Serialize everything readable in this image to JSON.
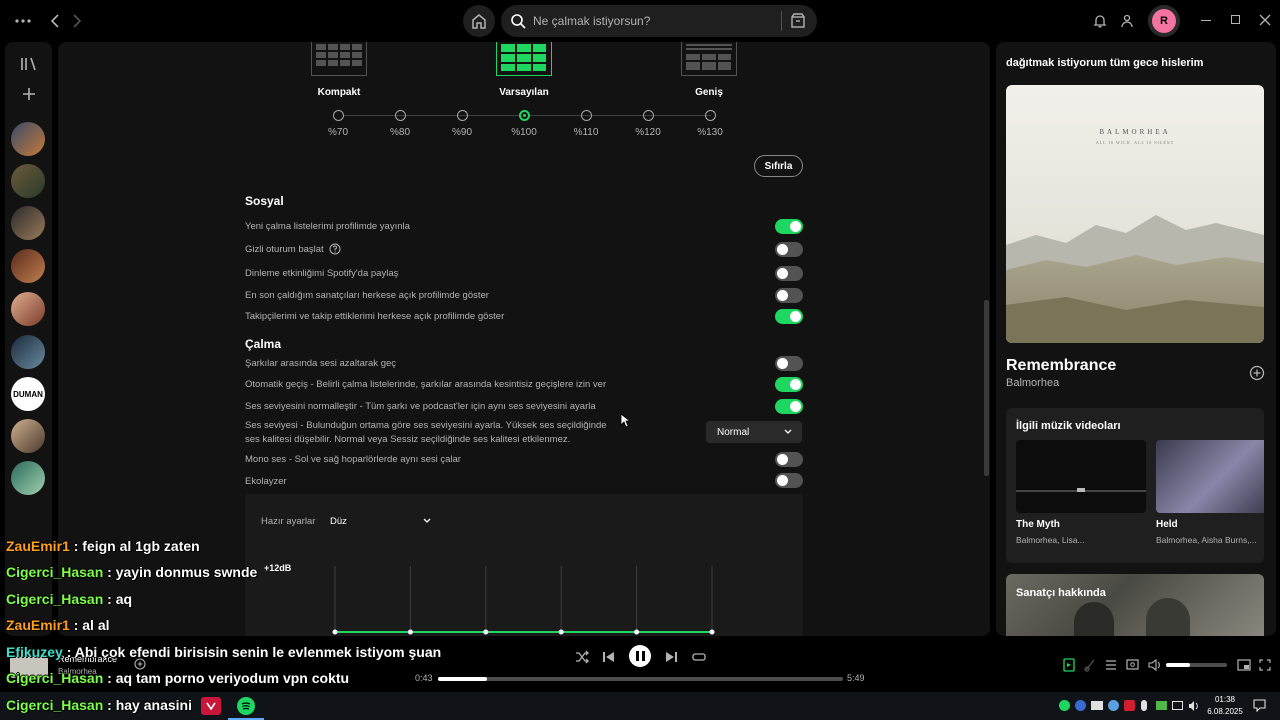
{
  "topbar": {
    "search_placeholder": "Ne çalmak istiyorsun?",
    "profile_initial": "R",
    "profile_color": "#f573a0"
  },
  "left_sidebar": {
    "avatars": [
      "artist-1",
      "artist-2",
      "artist-3",
      "artist-4",
      "artist-5",
      "artist-6",
      "DUMAN",
      "artist-8",
      "artist-9"
    ]
  },
  "display": {
    "layouts": [
      {
        "label": "Kompakt"
      },
      {
        "label": "Varsayılan"
      },
      {
        "label": "Geniş"
      }
    ],
    "zoom_levels": [
      "%70",
      "%80",
      "%90",
      "%100",
      "%110",
      "%120",
      "%130"
    ],
    "selected_zoom": "%100",
    "reset_label": "Sıfırla"
  },
  "social": {
    "title": "Sosyal",
    "rows": [
      {
        "label": "Yeni çalma listelerimi profilimde yayınla",
        "on": true
      },
      {
        "label": "Gizli oturum başlat",
        "on": false
      },
      {
        "label": "Dinleme etkinliğimi Spotify'da paylaş",
        "on": false
      },
      {
        "label": "En son çaldığım sanatçıları herkese açık profilimde göster",
        "on": false
      },
      {
        "label": "Takipçilerimi ve takip ettiklerimi herkese açık profilimde göster",
        "on": true
      }
    ]
  },
  "playback": {
    "title": "Çalma",
    "crossfade": {
      "label": "Şarkılar arasında sesi azaltarak geç",
      "on": false
    },
    "automix": {
      "label": "Otomatik geçiş - Belirli çalma listelerinde, şarkılar arasında kesintisiz geçişlere izin ver",
      "on": true
    },
    "normalize": {
      "label": "Ses seviyesini normalleştir - Tüm şarkı ve podcast'ler için aynı ses seviyesini ayarla",
      "on": true
    },
    "volume_level": {
      "label_line1": "Ses seviyesi - Bulunduğun ortama göre ses seviyesini ayarla. Yüksek ses seçildiğinde",
      "label_line2": "ses kalitesi düşebilir. Normal veya Sessiz seçildiğinde ses kalitesi etkilenmez.",
      "value": "Normal"
    },
    "mono": {
      "label": "Mono ses - Sol ve sağ hoparlörlerde aynı sesi çalar",
      "on": false
    },
    "equalizer": {
      "label": "Ekolayzer",
      "on": false
    }
  },
  "equalizer_panel": {
    "preset_label": "Hazır ayarlar",
    "preset_value": "Düz",
    "db_label": "+12dB",
    "band_count": 6
  },
  "right_panel": {
    "playlist_title": "dağıtmak istiyorum tüm gece hislerim",
    "album_art_text": "BALMORHEA",
    "album_art_subtext": "ALL IS WILD, ALL IS SILENT",
    "track_title": "Remembrance",
    "track_artist": "Balmorhea",
    "videos_title": "İlgili müzik videoları",
    "videos": [
      {
        "title": "The Myth",
        "artists": "Balmorhea, Lisa..."
      },
      {
        "title": "Held",
        "artists": "Balmorhea, Aisha Burns,..."
      }
    ],
    "about_title": "Sanatçı hakkında"
  },
  "player": {
    "track_title": "Remembrance",
    "track_artist": "Balmorhea",
    "elapsed": "0:43",
    "duration": "5:49",
    "progress": 0.12,
    "volume": 0.4
  },
  "chat": [
    {
      "user": "ZauEmir1",
      "message": " : feign al 1gb zaten",
      "color": "#ff9f1a"
    },
    {
      "user": "Cigerci_Hasan",
      "message": " : yayin donmus swnde",
      "color": "#7dff4a"
    },
    {
      "user": "Cigerci_Hasan",
      "message": " : aq",
      "color": "#7dff4a"
    },
    {
      "user": "ZauEmir1",
      "message": " : al al",
      "color": "#ff9f1a"
    },
    {
      "user": "Efikuzey",
      "message": " : Abi çok efendi birisisin senin le evlenmek istiyom şuan",
      "color": "#3de0c8"
    },
    {
      "user": "Cigerci_Hasan",
      "message": " : aq tam porno veriyodum vpn coktu",
      "color": "#7dff4a"
    },
    {
      "user": "Cigerci_Hasan",
      "message": " : hay anasini",
      "color": "#7dff4a"
    }
  ],
  "taskbar": {
    "time": "01:38",
    "date": "6.08.2025"
  },
  "colors": {
    "accent": "#1ed760",
    "panel": "#121212",
    "text_secondary": "#b3b3b3"
  }
}
